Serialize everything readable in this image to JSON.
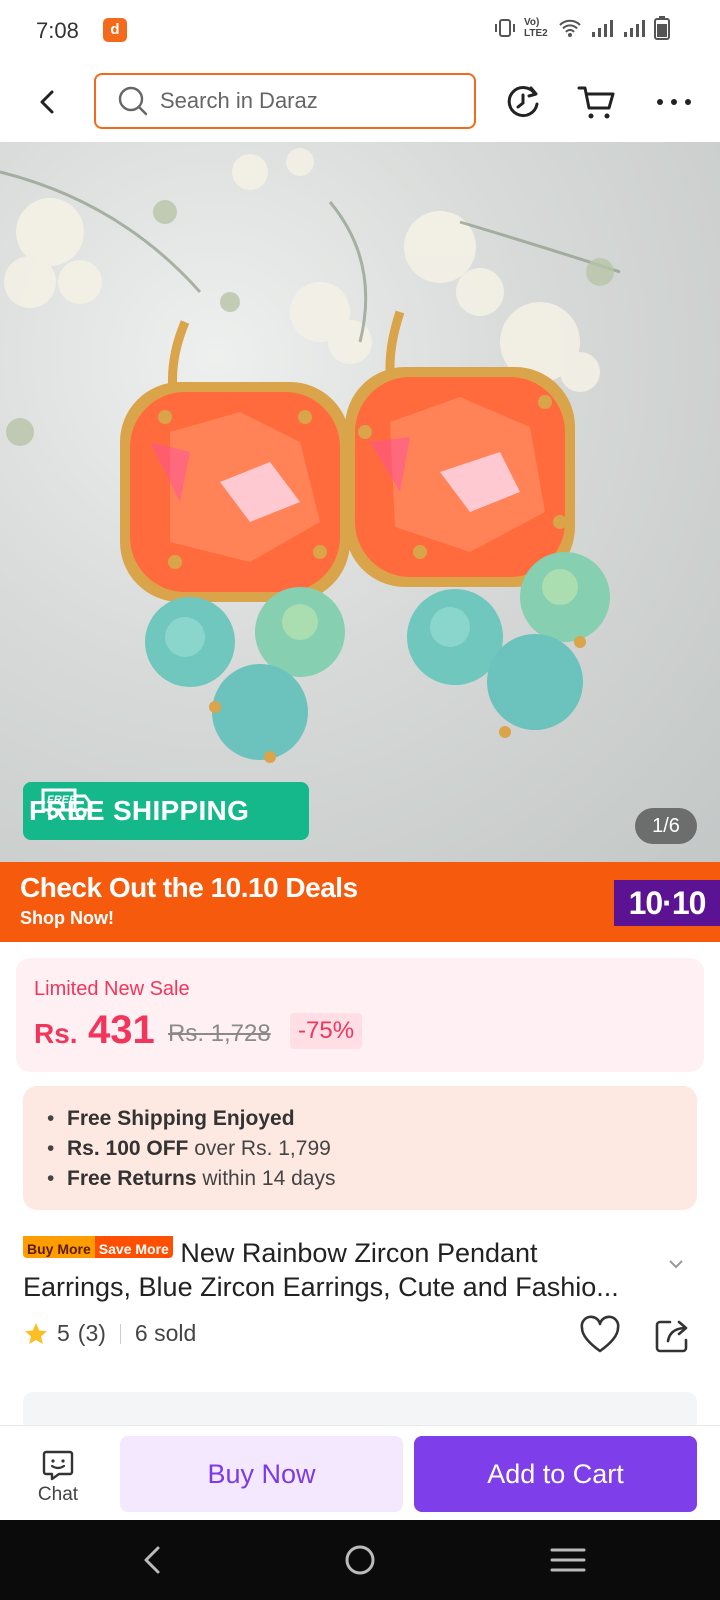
{
  "status_bar": {
    "time": "7:08",
    "app_icon": "daraz-app-icon",
    "network_label": "Vo) LTE2",
    "icons": [
      "vibrate-icon",
      "wifi-icon",
      "signal-icon",
      "signal-icon",
      "battery-icon"
    ]
  },
  "header": {
    "search_placeholder": "Search in Daraz",
    "icons": [
      "back-arrow-icon",
      "search-icon",
      "history-icon",
      "cart-icon",
      "more-icon"
    ]
  },
  "gallery": {
    "free_shipping_label": "FREE SHIPPING",
    "free_badge_text": "FREE",
    "counter": "1/6"
  },
  "deals_banner": {
    "title": "Check Out the 10.10 Deals",
    "subtitle": "Shop Now!",
    "badge": "10·10"
  },
  "price": {
    "sale_label": "Limited New Sale",
    "currency": "Rs.",
    "current": "431",
    "original": "Rs. 1,728",
    "discount": "-75%"
  },
  "benefits": [
    {
      "bold": "Free Shipping Enjoyed",
      "rest": ""
    },
    {
      "bold": "Rs. 100 OFF",
      "rest": " over Rs. 1,799"
    },
    {
      "bold": "Free Returns",
      "rest": " within 14 days"
    }
  ],
  "product": {
    "tag_left": "Buy More",
    "tag_right": "Save More",
    "title_line1": "New Rainbow Zircon Pendant",
    "title_line2": "Earrings, Blue Zircon Earrings, Cute and Fashio..."
  },
  "rating": {
    "score": "5",
    "count": "(3)",
    "sold": "6 sold"
  },
  "bottom_bar": {
    "chat_label": "Chat",
    "buy_now": "Buy Now",
    "add_to_cart": "Add to Cart"
  },
  "colors": {
    "brand_orange": "#f36a1d",
    "free_shipping_green": "#15b88a",
    "price_red": "#f2355a",
    "purple": "#7e3ee9"
  }
}
